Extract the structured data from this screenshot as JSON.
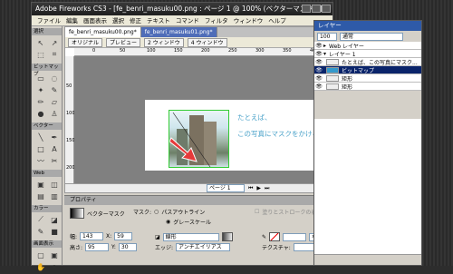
{
  "window": {
    "title": "Adobe Fireworks CS3 - [fe_benri_masuku00.png : ページ 1 @ 100% (ベクターマスク)*]"
  },
  "menu": [
    "ファイル",
    "編集",
    "画面表示",
    "選択",
    "修正",
    "テキスト",
    "コマンド",
    "フィルタ",
    "ウィンドウ",
    "ヘルプ"
  ],
  "toolbox": {
    "sections": [
      "選択",
      "ビットマップ",
      "ベクター",
      "Web",
      "カラー",
      "画面表示"
    ]
  },
  "doc": {
    "tabs": [
      "fe_benri_masuku00.png*",
      "fe_benri_masuku01.png*"
    ],
    "view_buttons": [
      "オリジナル",
      "プレビュー",
      "2 ウィンドウ",
      "4 ウィンドウ"
    ],
    "ruler_ticks": [
      "0",
      "50",
      "100",
      "150",
      "200",
      "250",
      "300",
      "350",
      "400"
    ],
    "ruler_left_ticks": [
      "50",
      "100",
      "150",
      "200"
    ],
    "art_text_line1": "たとえば、",
    "art_text_line2": "この写真にマスクをかける。",
    "page_label": "ページ 1"
  },
  "props": {
    "title": "プロパティ",
    "mask_label": "ベクターマスク",
    "mask_field_label": "マスク:",
    "mask_opt1": "パスアウトライン",
    "mask_opt2": "グレースケール",
    "show_stroke": "塗りとストロークの表示",
    "w_label": "幅:",
    "w": "143",
    "h_label": "高さ:",
    "h": "95",
    "x_label": "X:",
    "x": "59",
    "y_label": "Y:",
    "y": "30",
    "fill_type": "線形",
    "edge_label": "エッジ:",
    "edge": "アンチエイリアス",
    "stroke_none": "なし",
    "texture_label": "テクスチャ:"
  },
  "layers": {
    "title": "レイヤー",
    "opacity": "100",
    "blend": "通常",
    "rows": [
      {
        "name": "Web レイヤー",
        "selected": false
      },
      {
        "name": "レイヤー 1",
        "selected": false
      },
      {
        "name": "たとえば、この写真にマスク...",
        "selected": false
      },
      {
        "name": "ビットマップ",
        "selected": true
      },
      {
        "name": "矩形",
        "selected": false
      },
      {
        "name": "矩形",
        "selected": false
      }
    ]
  }
}
